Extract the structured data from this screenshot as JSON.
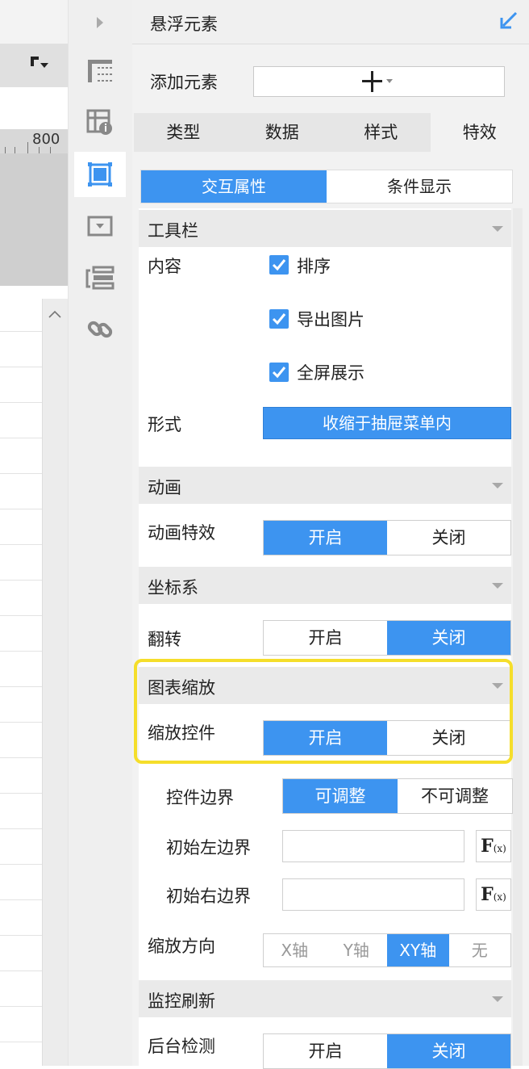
{
  "left_canvas": {
    "ruler_label": "800",
    "toolbar_icon": "format-painter-dropdown-icon"
  },
  "icon_column": {
    "items": [
      {
        "name": "collapse-arrow-icon"
      },
      {
        "name": "report-layout-icon"
      },
      {
        "name": "cell-properties-icon"
      },
      {
        "name": "floating-element-icon",
        "active": true
      },
      {
        "name": "widget-icon"
      },
      {
        "name": "component-list-icon"
      },
      {
        "name": "hyperlink-icon"
      }
    ]
  },
  "panel": {
    "title": "悬浮元素",
    "header_icon": "arrow-collapse-icon",
    "add_label": "添加元素",
    "add_symbol": "+",
    "tabs": [
      {
        "label": "类型"
      },
      {
        "label": "数据"
      },
      {
        "label": "样式"
      },
      {
        "label": "特效",
        "active": true
      }
    ],
    "subtabs": [
      {
        "label": "交互属性",
        "active": true
      },
      {
        "label": "条件显示"
      }
    ],
    "toolbar_section": {
      "title": "工具栏",
      "content_label": "内容",
      "checkboxes": [
        {
          "label": "排序",
          "checked": true
        },
        {
          "label": "导出图片",
          "checked": true
        },
        {
          "label": "全屏展示",
          "checked": true
        }
      ],
      "form_label": "形式",
      "form_value": "收缩于抽屉菜单内"
    },
    "animation_section": {
      "title": "动画",
      "effect_label": "动画特效",
      "options": [
        "开启",
        "关闭"
      ],
      "selected": "开启"
    },
    "coord_section": {
      "title": "坐标系",
      "flip_label": "翻转",
      "options": [
        "开启",
        "关闭"
      ],
      "selected": "关闭"
    },
    "zoom_section": {
      "title": "图表缩放",
      "control_label": "缩放控件",
      "options": [
        "开启",
        "关闭"
      ],
      "selected": "开启",
      "border_label": "控件边界",
      "border_options": [
        "可调整",
        "不可调整"
      ],
      "border_selected": "可调整",
      "left_label": "初始左边界",
      "left_value": "",
      "right_label": "初始右边界",
      "right_value": "",
      "fx_label": "F",
      "fx_sub": "(x)",
      "direction_label": "缩放方向",
      "direction_options": [
        "X轴",
        "Y轴",
        "XY轴",
        "无"
      ],
      "direction_selected": "XY轴"
    },
    "monitor_section": {
      "title": "监控刷新",
      "bg_label": "后台检测",
      "options": [
        "开启",
        "关闭"
      ],
      "selected": "关闭"
    }
  },
  "colors": {
    "accent": "#3d94f0",
    "highlight": "#f5de2b"
  }
}
